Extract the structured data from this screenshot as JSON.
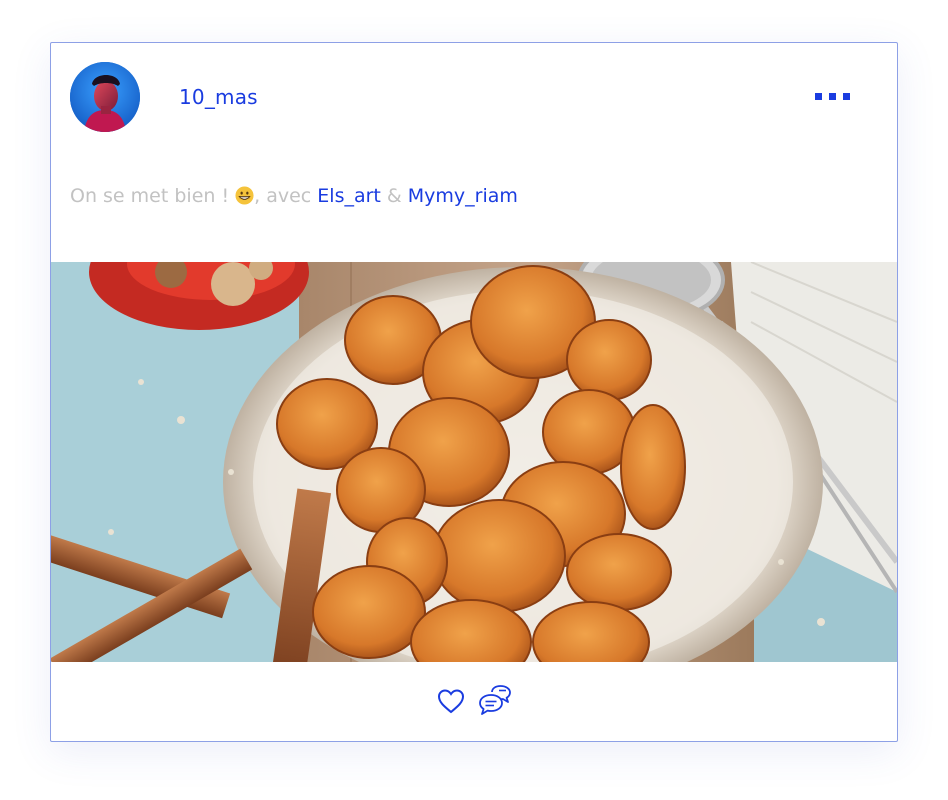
{
  "post": {
    "username": "10_mas",
    "caption": {
      "text_before": "On se met bien ! ",
      "emoji": "grinning-face-emoji",
      "text_middle": ", avec ",
      "mention_1": "Els_art",
      "separator": " & ",
      "mention_2": "Mymy_riam"
    },
    "photo": {
      "subject": "roasted-sweet-potato-chips-on-plate"
    },
    "actions": {
      "like_icon": "heart-icon",
      "comment_icon": "chat-bubbles-icon"
    }
  },
  "colors": {
    "accent": "#1a3ce0",
    "muted_text": "#c2c2c2",
    "border": "#8da0e6"
  }
}
